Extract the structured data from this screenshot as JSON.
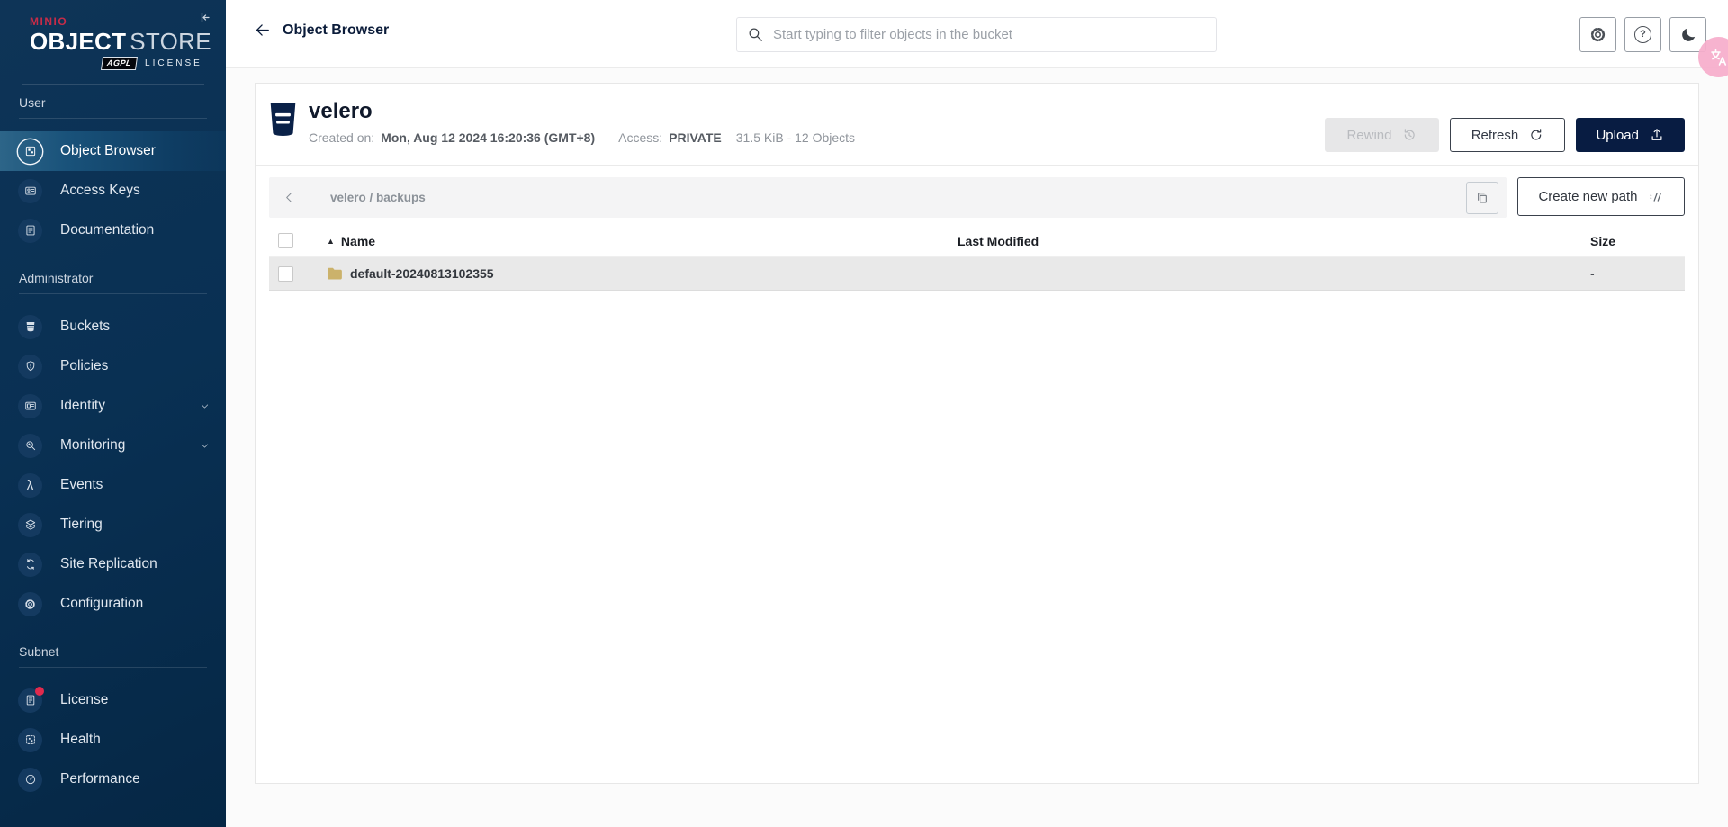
{
  "colors": {
    "brand-red": "#C72C48",
    "navy": "#081C42",
    "sidebar-top": "#0E3457",
    "sidebar-bottom": "#052745",
    "active-item": "#2D6588",
    "folder": "#CBB26B",
    "translate-badge": "#F7AECC",
    "row-gray": "#E9E9E9",
    "disabled-bg": "#E7E7E8",
    "disabled-text": "#B9BBBF"
  },
  "icons": {
    "help_glyph": "?",
    "events_lambda": "λ",
    "sort_asc": "▲"
  },
  "brand": {
    "minio": "MINIO",
    "object": "OBJECT",
    "store": "STORE",
    "agpl": "AGPL",
    "license": "LICENSE"
  },
  "sidebar": {
    "sections": [
      {
        "label": "User",
        "items": [
          {
            "label": "Object Browser"
          },
          {
            "label": "Access Keys"
          },
          {
            "label": "Documentation"
          }
        ]
      },
      {
        "label": "Administrator",
        "items": [
          {
            "label": "Buckets"
          },
          {
            "label": "Policies"
          },
          {
            "label": "Identity"
          },
          {
            "label": "Monitoring"
          },
          {
            "label": "Events"
          },
          {
            "label": "Tiering"
          },
          {
            "label": "Site Replication"
          },
          {
            "label": "Configuration"
          }
        ]
      },
      {
        "label": "Subnet",
        "items": [
          {
            "label": "License"
          },
          {
            "label": "Health"
          },
          {
            "label": "Performance"
          }
        ]
      }
    ]
  },
  "header": {
    "back_label": "Object Browser",
    "search": {
      "placeholder": "Start typing to filter objects in the bucket"
    }
  },
  "bucket": {
    "name": "velero",
    "created_label": "Created on:",
    "created_value": "Mon, Aug 12 2024 16:20:36 (GMT+8)",
    "access_label": "Access:",
    "access_value": "PRIVATE",
    "summary": "31.5 KiB - 12 Objects",
    "actions": {
      "rewind": "Rewind",
      "refresh": "Refresh",
      "upload": "Upload"
    }
  },
  "path_bar": {
    "path": "velero / backups",
    "create_button": "Create new path"
  },
  "table": {
    "columns": [
      "Name",
      "Last Modified",
      "Size"
    ],
    "rows": [
      {
        "name": "default-20240813102355",
        "last_modified": "",
        "size": "-"
      }
    ]
  }
}
